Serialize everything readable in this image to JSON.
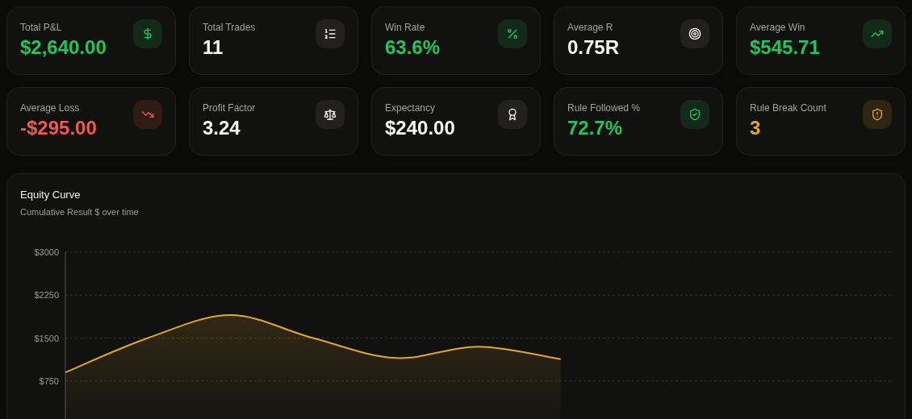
{
  "stats": [
    {
      "label": "Total P&L",
      "value": "$2,640.00",
      "color": "#22c55e"
    },
    {
      "label": "Total Trades",
      "value": "11",
      "color": "#f5f5f5"
    },
    {
      "label": "Win Rate",
      "value": "63.6%",
      "color": "#22c55e"
    },
    {
      "label": "Average R",
      "value": "0.75R",
      "color": "#f5f5f5"
    },
    {
      "label": "Average Win",
      "value": "$545.71",
      "color": "#22c55e"
    },
    {
      "label": "Average Loss",
      "value": "-$295.00",
      "color": "#f05a4a"
    },
    {
      "label": "Profit Factor",
      "value": "3.24",
      "color": "#f5f5f5"
    },
    {
      "label": "Expectancy",
      "value": "$240.00",
      "color": "#f5f5f5"
    },
    {
      "label": "Rule Followed %",
      "value": "72.7%",
      "color": "#22c55e"
    },
    {
      "label": "Rule Break Count",
      "value": "3",
      "color": "#e0a82e"
    }
  ],
  "equity_curve": {
    "title": "Equity Curve",
    "subtitle": "Cumulative Result $ over time",
    "chart_data": {
      "type": "area",
      "grid": true,
      "ylim": [
        0,
        3000
      ],
      "yticks": [
        {
          "value": 750,
          "label": "$750"
        },
        {
          "value": 1500,
          "label": "$1500"
        },
        {
          "value": 2250,
          "label": "$2250"
        },
        {
          "value": 3000,
          "label": "$3000"
        }
      ],
      "series": [
        {
          "color": "#e0a82e",
          "values": [
            900,
            1500,
            1900,
            1500,
            1150,
            1350,
            1130,
            null,
            null,
            null,
            null
          ]
        }
      ]
    }
  }
}
